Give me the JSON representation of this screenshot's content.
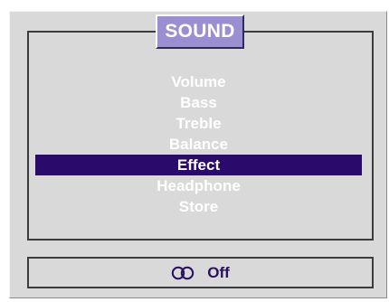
{
  "menu": {
    "title": "SOUND",
    "items": [
      {
        "label": "Volume",
        "selected": false
      },
      {
        "label": "Bass",
        "selected": false
      },
      {
        "label": "Treble",
        "selected": false
      },
      {
        "label": "Balance",
        "selected": false
      },
      {
        "label": "Effect",
        "selected": true
      },
      {
        "label": "Headphone",
        "selected": false
      },
      {
        "label": "Store",
        "selected": false
      }
    ]
  },
  "status": {
    "icon": "stereo-rings-icon",
    "value": "Off"
  },
  "colors": {
    "background": "#d9d9d9",
    "title_tab": "#9b8fd2",
    "selection": "#2a0a6b",
    "item_text": "#ffffff",
    "status_text": "#2a1060"
  }
}
